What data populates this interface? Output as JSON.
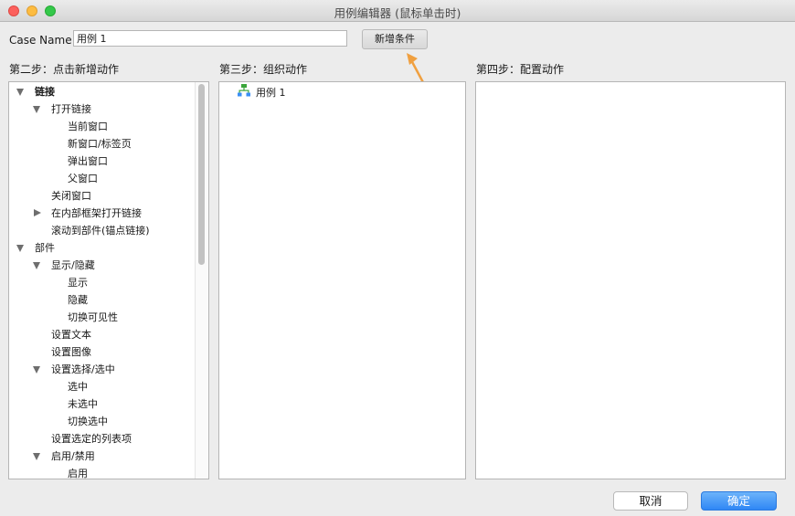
{
  "window": {
    "title": "用例编辑器 (鼠标单击时)"
  },
  "case": {
    "label": "Case Name",
    "value": "用例 1",
    "add_condition_button": "新增条件"
  },
  "steps": {
    "step2": "第二步：点击新增动作",
    "step3": "第三步：组织动作",
    "step4": "第四步：配置动作"
  },
  "actions_tree": [
    {
      "label": "链接",
      "level": 0,
      "toggle": "expanded",
      "bold": true
    },
    {
      "label": "打开链接",
      "level": 1,
      "toggle": "expanded"
    },
    {
      "label": "当前窗口",
      "level": 2
    },
    {
      "label": "新窗口/标签页",
      "level": 2
    },
    {
      "label": "弹出窗口",
      "level": 2
    },
    {
      "label": "父窗口",
      "level": 2
    },
    {
      "label": "关闭窗口",
      "level": 1
    },
    {
      "label": "在内部框架打开链接",
      "level": 1,
      "toggle": "collapsed"
    },
    {
      "label": "滚动到部件(锚点链接)",
      "level": 1
    },
    {
      "label": "部件",
      "level": 0,
      "toggle": "expanded"
    },
    {
      "label": "显示/隐藏",
      "level": 1,
      "toggle": "expanded"
    },
    {
      "label": "显示",
      "level": 2
    },
    {
      "label": "隐藏",
      "level": 2
    },
    {
      "label": "切换可见性",
      "level": 2
    },
    {
      "label": "设置文本",
      "level": 1
    },
    {
      "label": "设置图像",
      "level": 1
    },
    {
      "label": "设置选择/选中",
      "level": 1,
      "toggle": "expanded"
    },
    {
      "label": "选中",
      "level": 2
    },
    {
      "label": "未选中",
      "level": 2
    },
    {
      "label": "切换选中",
      "level": 2
    },
    {
      "label": "设置选定的列表项",
      "level": 1
    },
    {
      "label": "启用/禁用",
      "level": 1,
      "toggle": "expanded"
    },
    {
      "label": "启用",
      "level": 2
    }
  ],
  "organize": {
    "case_label": "用例 1",
    "case_icon": "case-tree-icon"
  },
  "footer": {
    "cancel": "取消",
    "ok": "确定"
  },
  "colors": {
    "accent_arrow": "#f0a040",
    "ok_button": "#3a8ef6",
    "case_icon": "#3ba53b"
  }
}
